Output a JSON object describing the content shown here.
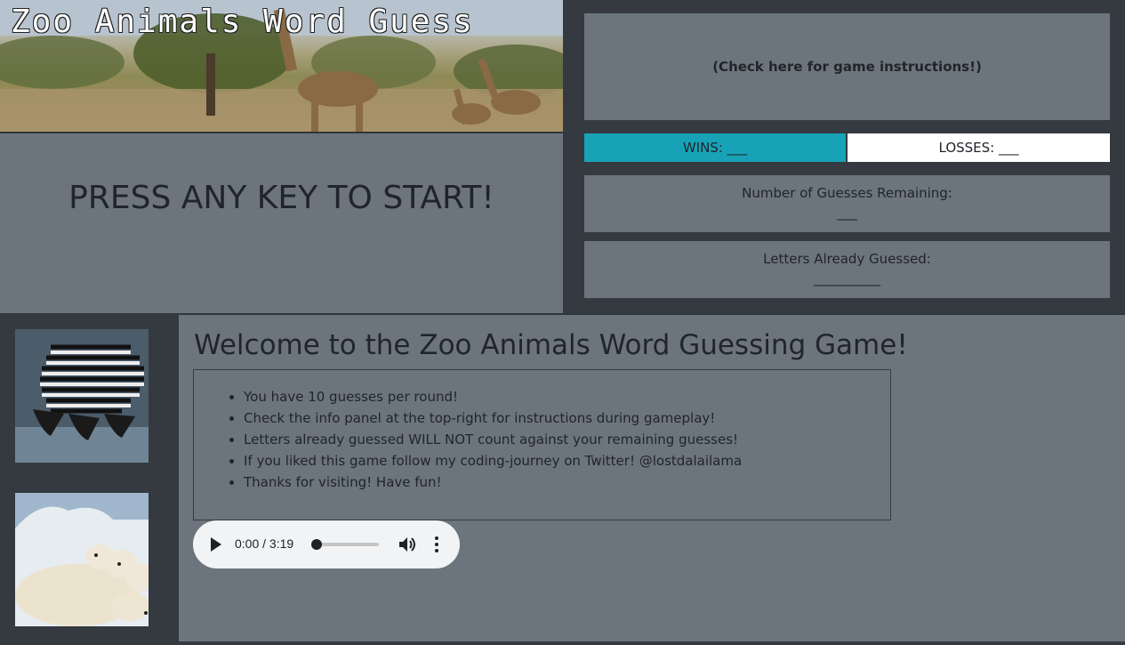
{
  "banner": {
    "title": "Zoo Animals Word Guess"
  },
  "start": {
    "prompt": "PRESS ANY KEY TO START!"
  },
  "instructions": {
    "label": "(Check here for game instructions!)"
  },
  "scoreboard": {
    "wins_label": "WINS: ___",
    "losses_label": "LOSSES: ___",
    "wins_color": "#17a2b8",
    "losses_color": "#ffffff"
  },
  "guesses": {
    "label": "Number of Guesses Remaining:",
    "value": "___"
  },
  "letters": {
    "label": "Letters Already Guessed:",
    "value": "__________"
  },
  "welcome": {
    "heading": "Welcome to the Zoo Animals Word Guessing Game!",
    "rules": [
      "You have 10 guesses per round!",
      "Check the info panel at the top-right for instructions during gameplay!",
      "Letters already guessed WILL NOT count against your remaining guesses!",
      "If you liked this game follow my coding-journey on Twitter! @lostdalailama",
      "Thanks for visiting! Have fun!"
    ]
  },
  "audio": {
    "time": "0:00 / 3:19",
    "progress": 0
  },
  "colors": {
    "page_bg": "#343a40",
    "panel_bg": "#6c757d",
    "accent": "#17a2b8"
  }
}
